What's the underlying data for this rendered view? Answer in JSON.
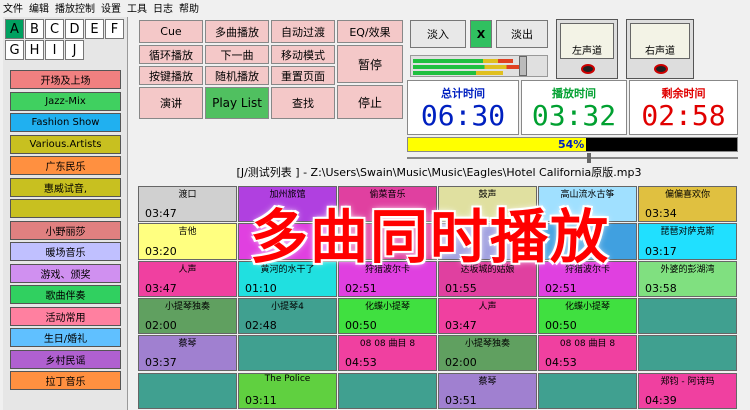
{
  "menu": [
    "文件",
    "编辑",
    "播放控制",
    "设置",
    "工具",
    "日志",
    "帮助"
  ],
  "letters": [
    "A",
    "B",
    "C",
    "D",
    "E",
    "F",
    "G",
    "H",
    "I",
    "J"
  ],
  "categories": [
    {
      "label": "开场及上场",
      "color": "#f08080"
    },
    {
      "label": "Jazz-Mix",
      "color": "#40d060"
    },
    {
      "label": "Fashion Show",
      "color": "#20b0f0"
    },
    {
      "label": "Various.Artists",
      "color": "#c8c020"
    },
    {
      "label": "广东民乐",
      "color": "#ff9040"
    },
    {
      "label": "惠威试音,",
      "color": "#c8c020"
    },
    {
      "label": "",
      "color": "#c8c020"
    },
    {
      "label": "小野丽莎",
      "color": "#e08080"
    },
    {
      "label": "暖场音乐",
      "color": "#c0c0ff"
    },
    {
      "label": "游戏、颁奖",
      "color": "#d090f0"
    },
    {
      "label": "歌曲伴奏",
      "color": "#30d060"
    },
    {
      "label": "活动常用",
      "color": "#ff80a0"
    },
    {
      "label": "生日/婚礼",
      "color": "#60c0ff"
    },
    {
      "label": "乡村民谣",
      "color": "#b060d0"
    },
    {
      "label": "拉丁音乐",
      "color": "#ff9040"
    }
  ],
  "controls": {
    "cue": "Cue",
    "multi": "多曲播放",
    "autofade": "自动过渡",
    "loop": "循环播放",
    "next": "下一曲",
    "move": "移动模式",
    "keyplay": "按键播放",
    "random": "随机播放",
    "resetpage": "重置页面",
    "speech": "演讲",
    "playlist": "Play List",
    "find": "查找",
    "eq": "EQ/效果",
    "pause": "暂停",
    "stop": "停止"
  },
  "fade": {
    "in": "淡入",
    "x": "X",
    "out": "淡出"
  },
  "meters": {
    "left": "左声道",
    "right": "右声道"
  },
  "times": {
    "total_label": "总计时间",
    "total": "06:30",
    "played_label": "播放时间",
    "played": "03:32",
    "remain_label": "剩余时间",
    "remain": "02:58"
  },
  "progress": {
    "percent": 0.54,
    "label": "54%"
  },
  "now_playing": "[J/测试列表 ] - Z:\\Users\\Swain\\Music\\Music\\Eagles\\Hotel California原版.mp3",
  "overlay": "多曲同时播放",
  "tiles": [
    {
      "name": "渡口",
      "dur": "03:47",
      "color": "#d0d0d0"
    },
    {
      "name": "加州旅馆",
      "dur": "",
      "color": "#b040e0"
    },
    {
      "name": "偷菜音乐",
      "dur": "",
      "color": "#e040a0"
    },
    {
      "name": "鼓声",
      "dur": "",
      "color": "#e0e0a0"
    },
    {
      "name": "高山流水古筝",
      "dur": "",
      "color": "#a0e0ff"
    },
    {
      "name": "偏偏喜欢你",
      "dur": "03:34",
      "color": "#e0c040"
    },
    {
      "name": "吉他",
      "dur": "03:20",
      "color": "#ffff80"
    },
    {
      "name": "",
      "dur": "",
      "color": "#e040e0"
    },
    {
      "name": "",
      "dur": "",
      "color": "#e040a0"
    },
    {
      "name": "",
      "dur": "",
      "color": "#a0a0e0"
    },
    {
      "name": "",
      "dur": "",
      "color": "#40a0e0"
    },
    {
      "name": "琵琶对萨克斯",
      "dur": "03:17",
      "color": "#20e0ff"
    },
    {
      "name": "人声",
      "dur": "03:47",
      "color": "#f040a0"
    },
    {
      "name": "黄河的水干了",
      "dur": "01:10",
      "color": "#20e0e0"
    },
    {
      "name": "狩猎波尔卡",
      "dur": "02:51",
      "color": "#e040e0"
    },
    {
      "name": "达坂城的姑娘",
      "dur": "01:55",
      "color": "#e040a0"
    },
    {
      "name": "狩猎波尔卡",
      "dur": "02:51",
      "color": "#e040e0"
    },
    {
      "name": "外婆的彭湖湾",
      "dur": "03:58",
      "color": "#80e080"
    },
    {
      "name": "小提琴独奏",
      "dur": "02:00",
      "color": "#60a060"
    },
    {
      "name": "小提琴4",
      "dur": "02:48",
      "color": "#40a090"
    },
    {
      "name": "化蝶小提琴",
      "dur": "00:50",
      "color": "#40e040"
    },
    {
      "name": "人声",
      "dur": "03:47",
      "color": "#f040a0"
    },
    {
      "name": "化蝶小提琴",
      "dur": "00:50",
      "color": "#40e040"
    },
    {
      "name": "",
      "dur": "",
      "color": "#40a090"
    },
    {
      "name": "蔡琴",
      "dur": "03:37",
      "color": "#a080d0"
    },
    {
      "name": "",
      "dur": "",
      "color": "#40a090"
    },
    {
      "name": "08 08 曲目 8",
      "dur": "04:53",
      "color": "#f040a0"
    },
    {
      "name": "小提琴独奏",
      "dur": "02:00",
      "color": "#60a060"
    },
    {
      "name": "08 08 曲目 8",
      "dur": "04:53",
      "color": "#f040a0"
    },
    {
      "name": "",
      "dur": "",
      "color": "#40a090"
    },
    {
      "name": "",
      "dur": "",
      "color": "#40a090"
    },
    {
      "name": "The Police",
      "dur": "03:11",
      "color": "#60d040"
    },
    {
      "name": "",
      "dur": "",
      "color": "#40a090"
    },
    {
      "name": "蔡琴",
      "dur": "03:51",
      "color": "#a080d0"
    },
    {
      "name": "",
      "dur": "",
      "color": "#40a090"
    },
    {
      "name": "郑钧 - 阿诗玛",
      "dur": "04:39",
      "color": "#f040a0"
    }
  ]
}
